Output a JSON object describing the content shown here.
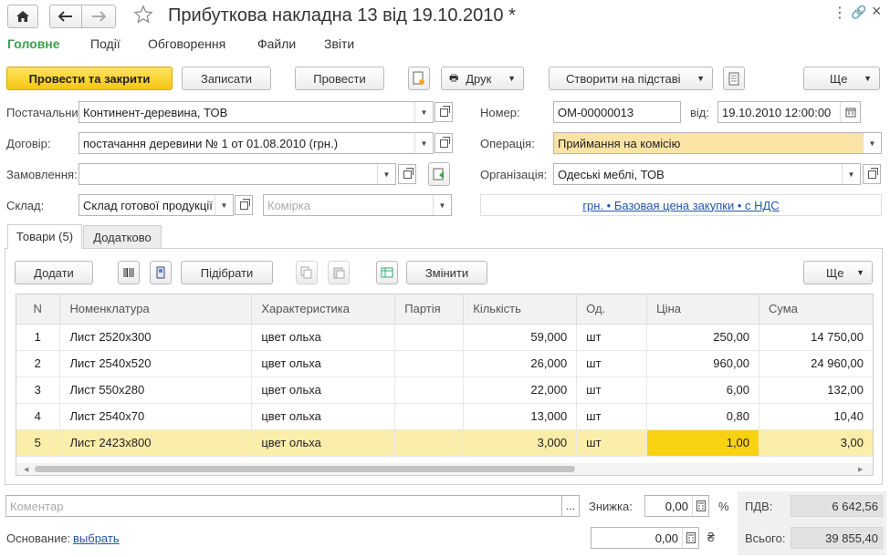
{
  "window": {
    "title": "Прибуткова накладна 13 від 19.10.2010 *"
  },
  "menu": [
    "Головне",
    "Події",
    "Обговорення",
    "Файли",
    "Звіти"
  ],
  "toolbar": {
    "post_close": "Провести та закрити",
    "save": "Записати",
    "post": "Провести",
    "print": "Друк",
    "create_based": "Створити на підставі",
    "more": "Ще"
  },
  "form": {
    "supplier_label": "Постачальник:",
    "supplier_value": "Континент-деревина, ТОВ",
    "contract_label": "Договір:",
    "contract_value": "постачання деревини № 1 от 01.08.2010 (грн.)",
    "order_label": "Замовлення:",
    "order_value": "",
    "warehouse_label": "Склад:",
    "warehouse_value": "Склад готової продукції",
    "cell_placeholder": "Комірка",
    "number_label": "Номер:",
    "number_value": "ОМ-00000013",
    "date_label": "від:",
    "date_value": "19.10.2010 12:00:00",
    "operation_label": "Операція:",
    "operation_value": "Приймання на комісію",
    "org_label": "Організація:",
    "org_value": "Одеські меблі, ТОВ",
    "price_link": "грн. • Базовая цена закупки • с НДС"
  },
  "tabs": [
    "Товари (5)",
    "Додатково"
  ],
  "table_toolbar": {
    "add": "Додати",
    "pick": "Підібрати",
    "change": "Змінити",
    "more": "Ще"
  },
  "table": {
    "headers": [
      "N",
      "Номенклатура",
      "Характеристика",
      "Партія",
      "Кількість",
      "Од.",
      "Ціна",
      "Сума"
    ],
    "rows": [
      [
        "1",
        "Лист 2520x300",
        "цвет ольха",
        "",
        "59,000",
        "шт",
        "250,00",
        "14 750,00"
      ],
      [
        "2",
        "Лист 2540x520",
        "цвет ольха",
        "",
        "26,000",
        "шт",
        "960,00",
        "24 960,00"
      ],
      [
        "3",
        "Лист 550x280",
        "цвет ольха",
        "",
        "22,000",
        "шт",
        "6,00",
        "132,00"
      ],
      [
        "4",
        "Лист 2540x70",
        "цвет ольха",
        "",
        "13,000",
        "шт",
        "0,80",
        "10,40"
      ],
      [
        "5",
        "Лист 2423x800",
        "цвет ольха",
        "",
        "3,000",
        "шт",
        "1,00",
        "3,00"
      ]
    ],
    "selected_row": 5
  },
  "footer": {
    "comment_placeholder": "Коментар",
    "comment_btn": "...",
    "discount_label": "Знижка:",
    "discount_value": "0,00",
    "percent": "%",
    "vat_label": "ПДВ:",
    "vat_value": "6 642,56",
    "basis_label": "Основание:",
    "basis_link": "выбрать",
    "amount_value": "0,00",
    "currency": "₴",
    "total_label": "Всього:",
    "total_value": "39 855,40"
  },
  "colors": {
    "menu_active": "#3aa24a",
    "primary_button": "#f5c613",
    "operation_highlight": "#fbe3a6",
    "selected_row": "#fbeeab",
    "current_cell": "#f8d210",
    "link": "#2255aa"
  }
}
